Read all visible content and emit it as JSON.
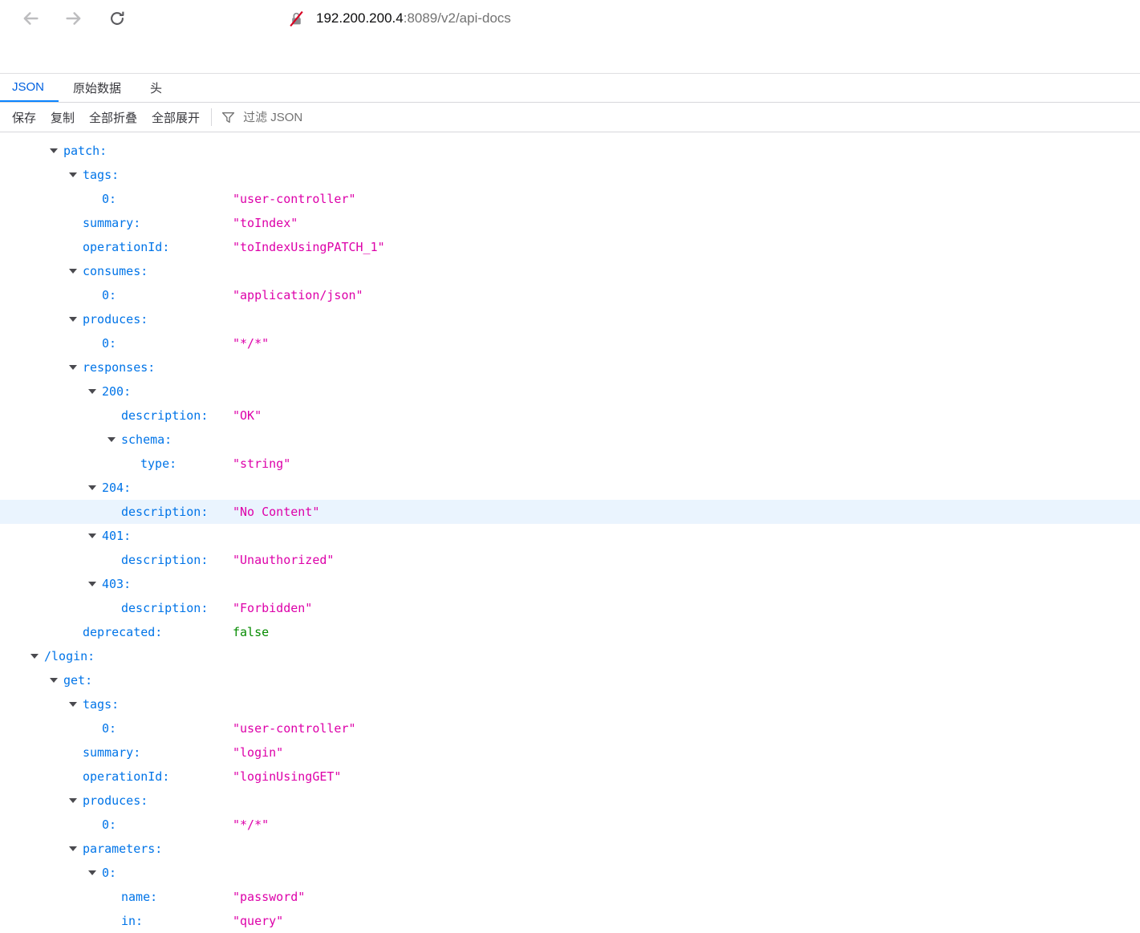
{
  "browser": {
    "url_host": "192.200.200.4",
    "url_rest": ":8089/v2/api-docs"
  },
  "tabs": [
    {
      "label": "JSON",
      "active": true
    },
    {
      "label": "原始数据",
      "active": false
    },
    {
      "label": "头",
      "active": false
    }
  ],
  "toolbar": {
    "save": "保存",
    "copy": "复制",
    "collapse_all": "全部折叠",
    "expand_all": "全部展开",
    "filter_placeholder": "过滤 JSON"
  },
  "colors": {
    "key": "#0074e8",
    "string_value": "#dd00a9",
    "boolean_value": "#058b00",
    "row_highlight": "#eaf4fe",
    "accent": "#0a84ff"
  },
  "json_tree": {
    "rows": [
      {
        "level": 1,
        "arrow": true,
        "key": "patch:"
      },
      {
        "level": 2,
        "arrow": true,
        "key": "tags:"
      },
      {
        "level": 3,
        "arrow": false,
        "key": "0:",
        "value": "\"user-controller\"",
        "type": "string"
      },
      {
        "level": 2,
        "arrow": false,
        "key": "summary:",
        "value": "\"toIndex\"",
        "type": "string"
      },
      {
        "level": 2,
        "arrow": false,
        "key": "operationId:",
        "value": "\"toIndexUsingPATCH_1\"",
        "type": "string"
      },
      {
        "level": 2,
        "arrow": true,
        "key": "consumes:"
      },
      {
        "level": 3,
        "arrow": false,
        "key": "0:",
        "value": "\"application/json\"",
        "type": "string"
      },
      {
        "level": 2,
        "arrow": true,
        "key": "produces:"
      },
      {
        "level": 3,
        "arrow": false,
        "key": "0:",
        "value": "\"*/*\"",
        "type": "string"
      },
      {
        "level": 2,
        "arrow": true,
        "key": "responses:"
      },
      {
        "level": 3,
        "arrow": true,
        "key": "200:"
      },
      {
        "level": 4,
        "arrow": false,
        "key": "description:",
        "value": "\"OK\"",
        "type": "string"
      },
      {
        "level": 4,
        "arrow": true,
        "key": "schema:"
      },
      {
        "level": 5,
        "arrow": false,
        "key": "type:",
        "value": "\"string\"",
        "type": "string"
      },
      {
        "level": 3,
        "arrow": true,
        "key": "204:"
      },
      {
        "level": 4,
        "arrow": false,
        "key": "description:",
        "value": "\"No Content\"",
        "type": "string",
        "highlight": true
      },
      {
        "level": 3,
        "arrow": true,
        "key": "401:"
      },
      {
        "level": 4,
        "arrow": false,
        "key": "description:",
        "value": "\"Unauthorized\"",
        "type": "string"
      },
      {
        "level": 3,
        "arrow": true,
        "key": "403:"
      },
      {
        "level": 4,
        "arrow": false,
        "key": "description:",
        "value": "\"Forbidden\"",
        "type": "string"
      },
      {
        "level": 2,
        "arrow": false,
        "key": "deprecated:",
        "value": "false",
        "type": "boolean"
      },
      {
        "level": 0,
        "arrow": true,
        "key": "/login:"
      },
      {
        "level": 1,
        "arrow": true,
        "key": "get:"
      },
      {
        "level": 2,
        "arrow": true,
        "key": "tags:"
      },
      {
        "level": 3,
        "arrow": false,
        "key": "0:",
        "value": "\"user-controller\"",
        "type": "string"
      },
      {
        "level": 2,
        "arrow": false,
        "key": "summary:",
        "value": "\"login\"",
        "type": "string"
      },
      {
        "level": 2,
        "arrow": false,
        "key": "operationId:",
        "value": "\"loginUsingGET\"",
        "type": "string"
      },
      {
        "level": 2,
        "arrow": true,
        "key": "produces:"
      },
      {
        "level": 3,
        "arrow": false,
        "key": "0:",
        "value": "\"*/*\"",
        "type": "string"
      },
      {
        "level": 2,
        "arrow": true,
        "key": "parameters:"
      },
      {
        "level": 3,
        "arrow": true,
        "key": "0:"
      },
      {
        "level": 4,
        "arrow": false,
        "key": "name:",
        "value": "\"password\"",
        "type": "string"
      },
      {
        "level": 4,
        "arrow": false,
        "key": "in:",
        "value": "\"query\"",
        "type": "string"
      }
    ]
  }
}
